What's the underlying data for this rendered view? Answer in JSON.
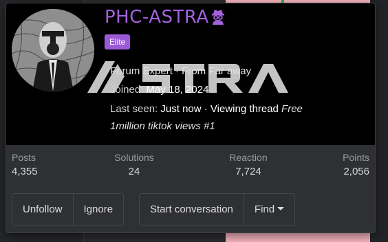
{
  "profile": {
    "username": "PHC-ASTRA",
    "badge": "Elite",
    "title_line": "Forum Expert · From Far away",
    "joined_label": "Joined:",
    "joined_value": "May 18, 2024",
    "last_seen_label": "Last seen:",
    "last_seen_value": "Just now · Viewing thread",
    "thread_title_part1": "Free",
    "thread_title_part2": "1million tiktok views #1",
    "watermark_text": "ASTRA",
    "username_color": "#a361e0",
    "badge_color": "#9b59d6",
    "user_icon": "detective-icon"
  },
  "stats": {
    "posts_label": "Posts",
    "posts_value": "4,355",
    "solutions_label": "Solutions",
    "solutions_value": "24",
    "reaction_label": "Reaction",
    "reaction_value": "7,724",
    "points_label": "Points",
    "points_value": "2,056"
  },
  "actions": {
    "unfollow": "Unfollow",
    "ignore": "Ignore",
    "start_conversation": "Start conversation",
    "find": "Find"
  }
}
